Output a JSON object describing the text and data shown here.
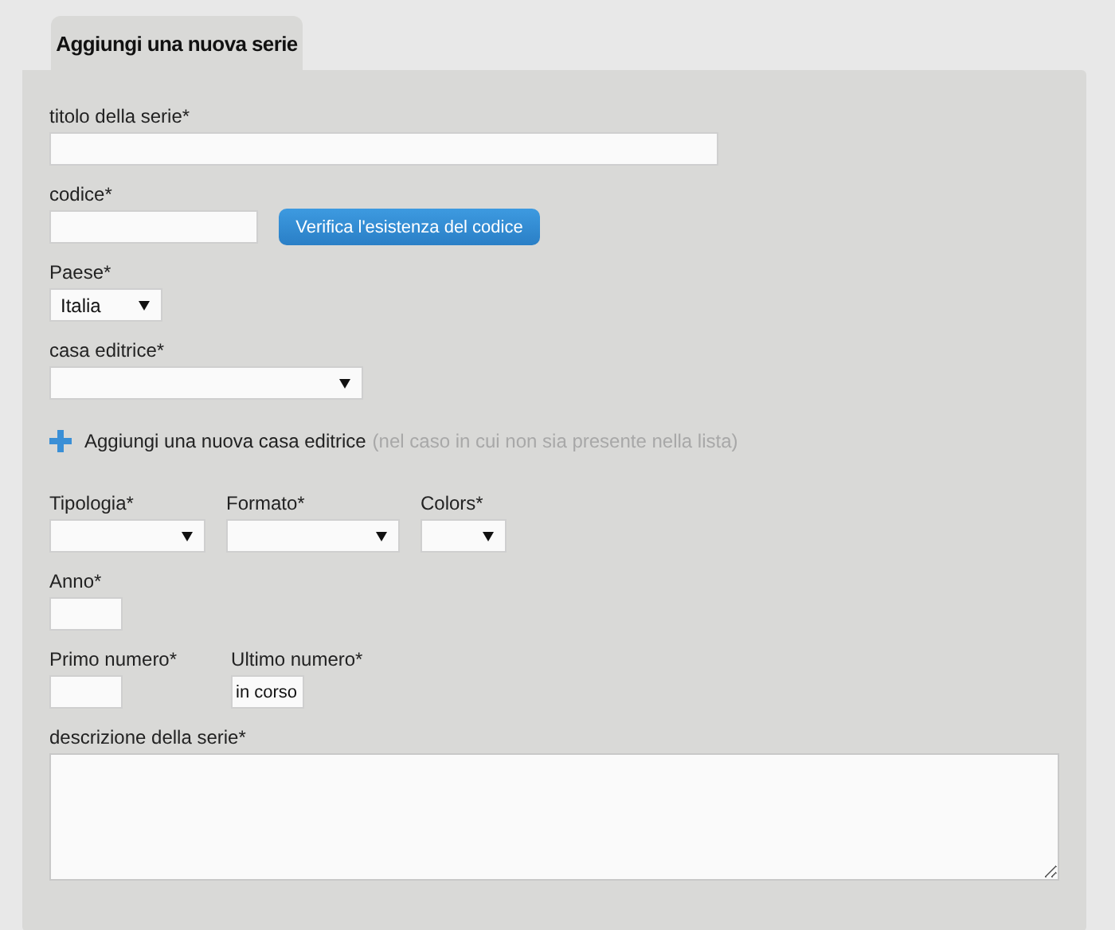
{
  "tab": {
    "label": "Aggiungi una nuova serie",
    "selected": true
  },
  "rows": [
    {
      "kind": "fields",
      "fields": [
        {
          "kind": "text",
          "label": "titolo della serie*"
        }
      ]
    },
    {
      "kind": "fields",
      "fields": [
        {
          "kind": "text",
          "label": "codice*"
        }
      ],
      "button": "Verifica l'esistenza del codice"
    },
    {
      "kind": "fields",
      "fields": [
        {
          "kind": "select",
          "label": "Paese*",
          "value": "Italia"
        }
      ]
    },
    {
      "kind": "fields",
      "fields": [
        {
          "kind": "select",
          "label": "casa editrice*"
        }
      ]
    },
    {
      "kind": "add_link",
      "label": "Aggiungi una nuova casa editrice",
      "hint": "(nel caso in cui non sia presente nella lista)"
    },
    {
      "kind": "fields",
      "fields": [
        {
          "kind": "select",
          "label": "Tipologia*"
        },
        {
          "kind": "select",
          "label": "Formato*"
        },
        {
          "kind": "select",
          "label": "Colors*"
        }
      ]
    },
    {
      "kind": "fields",
      "fields": [
        {
          "kind": "text",
          "label": "Anno*"
        }
      ]
    },
    {
      "kind": "fields",
      "fields": [
        {
          "kind": "text",
          "label": "Primo numero*"
        },
        {
          "kind": "text",
          "label": "Ultimo numero*",
          "value": "in corso"
        }
      ]
    },
    {
      "kind": "fields",
      "fields": [
        {
          "kind": "textarea",
          "label": "descrizione della serie*"
        }
      ]
    }
  ]
}
